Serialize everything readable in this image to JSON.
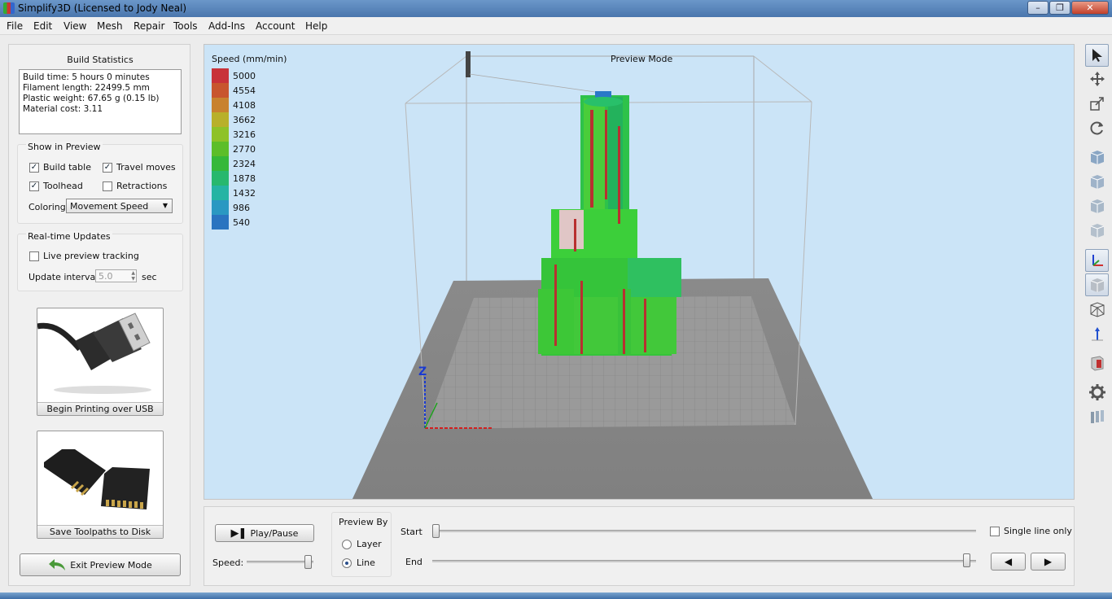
{
  "window": {
    "title": "Simplify3D (Licensed to Jody Neal)"
  },
  "menu": [
    "File",
    "Edit",
    "View",
    "Mesh",
    "Repair",
    "Tools",
    "Add-Ins",
    "Account",
    "Help"
  ],
  "build_statistics": {
    "title": "Build Statistics",
    "lines": [
      "Build time: 5 hours 0 minutes",
      "Filament length: 22499.5 mm",
      "Plastic weight: 67.65 g (0.15 lb)",
      "Material cost: 3.11"
    ]
  },
  "show_in_preview": {
    "title": "Show in Preview",
    "build_table": {
      "label": "Build table",
      "checked": true
    },
    "travel_moves": {
      "label": "Travel moves",
      "checked": true
    },
    "toolhead": {
      "label": "Toolhead",
      "checked": true
    },
    "retractions": {
      "label": "Retractions",
      "checked": false
    },
    "coloring_label": "Coloring",
    "coloring_value": "Movement Speed"
  },
  "realtime": {
    "title": "Real-time Updates",
    "live_tracking": {
      "label": "Live preview tracking",
      "checked": false
    },
    "interval_label": "Update interval",
    "interval_value": "5.0",
    "interval_unit": "sec"
  },
  "buttons": {
    "usb": "Begin Printing over USB",
    "disk": "Save Toolpaths to Disk",
    "exit": "Exit Preview Mode"
  },
  "viewport": {
    "mode_label": "Preview Mode",
    "axis_label": "Z",
    "legend_title": "Speed (mm/min)",
    "legend": [
      {
        "value": "5000",
        "color": "#c8323a"
      },
      {
        "value": "4554",
        "color": "#c8552e"
      },
      {
        "value": "4108",
        "color": "#c8822f"
      },
      {
        "value": "3662",
        "color": "#b8b02a"
      },
      {
        "value": "3216",
        "color": "#8ec228"
      },
      {
        "value": "2770",
        "color": "#5cbe2a"
      },
      {
        "value": "2324",
        "color": "#35b83a"
      },
      {
        "value": "1878",
        "color": "#27b86e"
      },
      {
        "value": "1432",
        "color": "#25b4a4"
      },
      {
        "value": "986",
        "color": "#2a98c2"
      },
      {
        "value": "540",
        "color": "#2a74c0"
      }
    ]
  },
  "playback": {
    "play_pause": "Play/Pause",
    "speed_label": "Speed:",
    "speed_level": 0.95,
    "preview_by_title": "Preview By",
    "preview_by_options": [
      {
        "label": "Layer",
        "selected": false
      },
      {
        "label": "Line",
        "selected": true
      }
    ],
    "start_label": "Start",
    "end_label": "End",
    "start_fraction": 0.0,
    "end_fraction": 1.0,
    "single_line": {
      "label": "Single line only",
      "checked": false
    }
  },
  "toolbar_icons": [
    "select-icon",
    "move-icon",
    "scale-icon",
    "rotate-icon",
    "view-cube-icon",
    "view-front-icon",
    "view-side-icon",
    "view-top-icon",
    "axes-icon",
    "solid-icon",
    "wireframe-icon",
    "normals-icon",
    "cross-section-icon",
    "settings-icon",
    "layers-icon"
  ]
}
